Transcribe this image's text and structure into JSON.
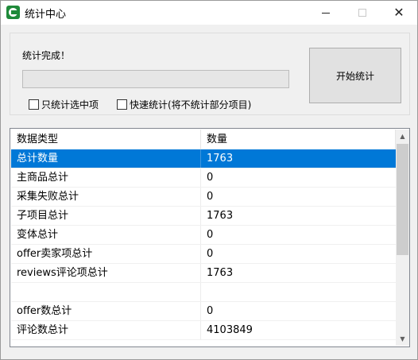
{
  "window": {
    "title": "统计中心",
    "close_glyph": "✕"
  },
  "status": {
    "text": "统计完成！",
    "progress": 0
  },
  "options": {
    "selected_only": {
      "label": "只统计选中项",
      "checked": false
    },
    "quick_stats": {
      "label": "快速统计(将不统计部分项目)",
      "checked": false
    }
  },
  "start_button": {
    "label": "开始统计"
  },
  "table": {
    "columns": [
      "数据类型",
      "数量"
    ],
    "rows": [
      {
        "type": "总计数量",
        "count": "1763",
        "selected": true
      },
      {
        "type": "主商品总计",
        "count": "0"
      },
      {
        "type": "采集失败总计",
        "count": "0"
      },
      {
        "type": "子项目总计",
        "count": "1763"
      },
      {
        "type": "变体总计",
        "count": "0"
      },
      {
        "type": "offer卖家项总计",
        "count": "0"
      },
      {
        "type": "reviews评论项总计",
        "count": "1763"
      },
      {
        "type": "",
        "count": ""
      },
      {
        "type": "offer数总计",
        "count": "0"
      },
      {
        "type": "评论数总计",
        "count": "4103849"
      }
    ]
  },
  "colors": {
    "selection": "#0078d7",
    "progress_fill": "#06b025"
  }
}
